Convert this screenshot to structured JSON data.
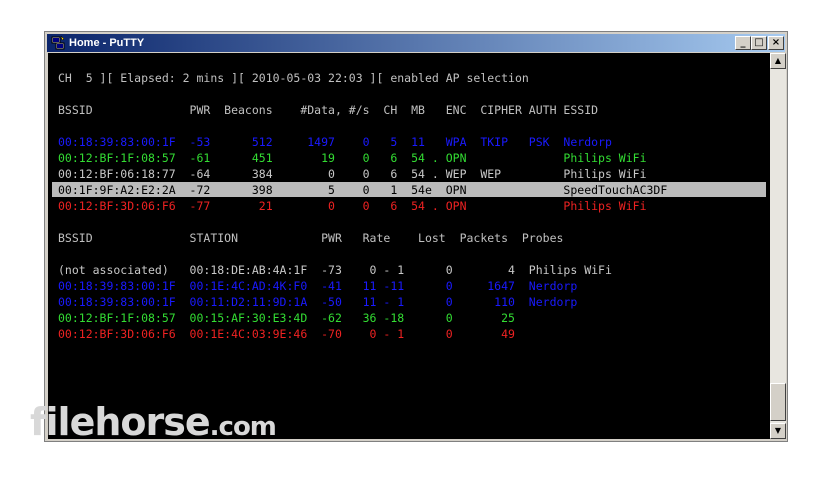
{
  "window": {
    "title": "Home - PuTTY",
    "buttons": {
      "minimize": "_",
      "maximize": "□",
      "close": "×"
    }
  },
  "terminal": {
    "status_line": "CH  5 ][ Elapsed: 2 mins ][ 2010-05-03 22:03 ][ enabled AP selection",
    "ap_header": "BSSID              PWR  Beacons    #Data, #/s  CH  MB   ENC  CIPHER AUTH ESSID",
    "ap_rows": [
      {
        "text": "00:18:39:83:00:1F  -53      512     1497    0   5  11   WPA  TKIP   PSK  Nerdorp",
        "color": "#1a1aff"
      },
      {
        "text": "00:12:BF:1F:08:57  -61      451       19    0   6  54 . OPN              Philips WiFi",
        "color": "#33dd33"
      },
      {
        "text": "00:12:BF:06:18:77  -64      384        0    0   6  54 . WEP  WEP         Philips WiFi",
        "color": "#c8c8c8"
      },
      {
        "text": "00:1F:9F:A2:E2:2A  -72      398        5    0   1  54e  OPN              SpeedTouchAC3DF",
        "color": "#000000",
        "highlight": true
      },
      {
        "text": "00:12:BF:3D:06:F6  -77       21        0    0   6  54 . OPN              Philips WiFi",
        "color": "#ee2222"
      }
    ],
    "station_header": "BSSID              STATION            PWR   Rate    Lost  Packets  Probes",
    "station_rows": [
      {
        "text": "(not associated)   00:18:DE:AB:4A:1F  -73    0 - 1      0        4  Philips WiFi",
        "color": "#c8c8c8"
      },
      {
        "text": "00:18:39:83:00:1F  00:1E:4C:AD:4K:F0  -41   11 -11      0     1647  Nerdorp",
        "color": "#1a1aff"
      },
      {
        "text": "00:18:39:83:00:1F  00:11:D2:11:9D:1A  -50   11 - 1      0      110  Nerdorp",
        "color": "#1a1aff"
      },
      {
        "text": "00:12:BF:1F:08:57  00:15:AF:30:E3:4D  -62   36 -18      0       25",
        "color": "#33dd33"
      },
      {
        "text": "00:12:BF:3D:06:F6  00:1E:4C:03:9E:46  -70    0 - 1      0       49",
        "color": "#ee2222"
      }
    ]
  },
  "scrollbar": {
    "up_arrow": "▲",
    "down_arrow": "▼"
  },
  "watermark": {
    "text": "filehorse",
    "suffix": ".com"
  }
}
